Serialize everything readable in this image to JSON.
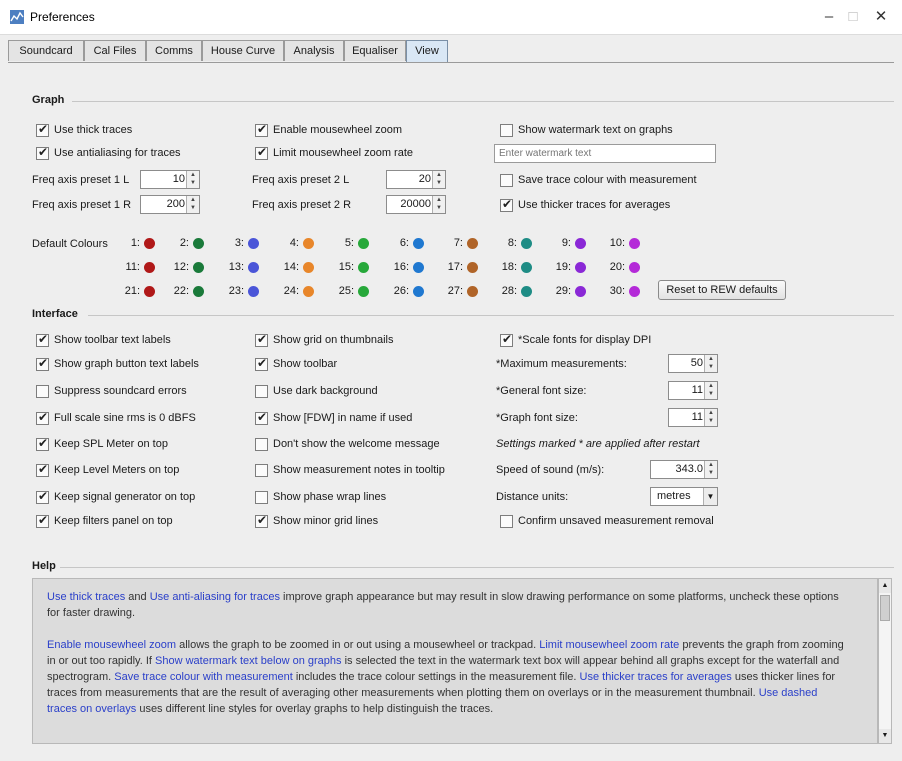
{
  "window": {
    "title": "Preferences",
    "minimize": "–",
    "maximize": "□",
    "close": "✕"
  },
  "tabs": [
    "Soundcard",
    "Cal Files",
    "Comms",
    "House Curve",
    "Analysis",
    "Equaliser",
    "View"
  ],
  "graph": {
    "section_title": "Graph",
    "col1": [
      {
        "label": "Use thick traces",
        "checked": true
      },
      {
        "label": "Use antialiasing for traces",
        "checked": true
      }
    ],
    "col2": [
      {
        "label": "Enable mousewheel zoom",
        "checked": true
      },
      {
        "label": "Limit mousewheel zoom rate",
        "checked": true
      }
    ],
    "col3": [
      {
        "label": "Show watermark text on graphs",
        "checked": false
      }
    ],
    "watermark_placeholder": "Enter watermark text",
    "presets": {
      "p1l_label": "Freq axis preset 1 L",
      "p1l_value": "10",
      "p1r_label": "Freq axis preset 1 R",
      "p1r_value": "200",
      "p2l_label": "Freq axis preset 2 L",
      "p2l_value": "20",
      "p2r_label": "Freq axis preset 2 R",
      "p2r_value": "20000"
    },
    "save_trace_colour": {
      "label": "Save trace colour with measurement",
      "checked": false
    },
    "thicker_averages": {
      "label": "Use thicker traces for averages",
      "checked": true
    },
    "default_colours_label": "Default Colours",
    "colours": [
      {
        "n": "1:",
        "c": "#b01818"
      },
      {
        "n": "2:",
        "c": "#1a7a3a"
      },
      {
        "n": "3:",
        "c": "#4a55d8"
      },
      {
        "n": "4:",
        "c": "#e8862a"
      },
      {
        "n": "5:",
        "c": "#27a83a"
      },
      {
        "n": "6:",
        "c": "#1f78d0"
      },
      {
        "n": "7:",
        "c": "#b06428"
      },
      {
        "n": "8:",
        "c": "#1e8c85"
      },
      {
        "n": "9:",
        "c": "#8a28d6"
      },
      {
        "n": "10:",
        "c": "#b42ad8"
      },
      {
        "n": "11:",
        "c": "#b01818"
      },
      {
        "n": "12:",
        "c": "#1a7a3a"
      },
      {
        "n": "13:",
        "c": "#4a55d8"
      },
      {
        "n": "14:",
        "c": "#e8862a"
      },
      {
        "n": "15:",
        "c": "#27a83a"
      },
      {
        "n": "16:",
        "c": "#1f78d0"
      },
      {
        "n": "17:",
        "c": "#b06428"
      },
      {
        "n": "18:",
        "c": "#1e8c85"
      },
      {
        "n": "19:",
        "c": "#8a28d6"
      },
      {
        "n": "20:",
        "c": "#b42ad8"
      },
      {
        "n": "21:",
        "c": "#b01818"
      },
      {
        "n": "22:",
        "c": "#1a7a3a"
      },
      {
        "n": "23:",
        "c": "#4a55d8"
      },
      {
        "n": "24:",
        "c": "#e8862a"
      },
      {
        "n": "25:",
        "c": "#27a83a"
      },
      {
        "n": "26:",
        "c": "#1f78d0"
      },
      {
        "n": "27:",
        "c": "#b06428"
      },
      {
        "n": "28:",
        "c": "#1e8c85"
      },
      {
        "n": "29:",
        "c": "#8a28d6"
      },
      {
        "n": "30:",
        "c": "#b42ad8"
      }
    ],
    "reset_button": "Reset to REW defaults"
  },
  "interface": {
    "section_title": "Interface",
    "col1": [
      {
        "label": "Show toolbar text labels",
        "checked": true
      },
      {
        "label": "Show graph button text labels",
        "checked": true
      },
      {
        "label": "Suppress soundcard errors",
        "checked": false
      },
      {
        "label": "Full scale sine rms is 0 dBFS",
        "checked": true
      },
      {
        "label": "Keep SPL Meter on top",
        "checked": true
      },
      {
        "label": "Keep Level Meters on top",
        "checked": true
      },
      {
        "label": "Keep signal generator on top",
        "checked": true
      },
      {
        "label": "Keep filters panel on top",
        "checked": true
      }
    ],
    "col2": [
      {
        "label": "Show grid on thumbnails",
        "checked": true
      },
      {
        "label": "Show toolbar",
        "checked": true
      },
      {
        "label": "Use dark background",
        "checked": false
      },
      {
        "label": "Show [FDW] in name if used",
        "checked": true
      },
      {
        "label": "Don't show the welcome message",
        "checked": false
      },
      {
        "label": "Show measurement notes in tooltip",
        "checked": false
      },
      {
        "label": "Show phase wrap lines",
        "checked": false
      },
      {
        "label": "Show minor grid lines",
        "checked": true
      }
    ],
    "scale_fonts": {
      "label": "*Scale fonts for display DPI",
      "checked": true
    },
    "max_meas_label": "*Maximum measurements:",
    "max_meas_value": "50",
    "gen_font_label": "*General font size:",
    "gen_font_value": "11",
    "graph_font_label": "*Graph font size:",
    "graph_font_value": "11",
    "restart_note": "Settings marked * are applied after restart",
    "sos_label": "Speed of sound (m/s):",
    "sos_value": "343.0",
    "dist_label": "Distance units:",
    "dist_value": "metres",
    "confirm_unsaved": {
      "label": "Confirm unsaved measurement removal",
      "checked": false
    }
  },
  "help": {
    "section_title": "Help",
    "p1": [
      {
        "t": "Use thick traces",
        "h": true
      },
      {
        "t": " and ",
        "h": false
      },
      {
        "t": "Use anti-aliasing for traces",
        "h": true
      },
      {
        "t": " improve graph appearance but may result in slow drawing performance on some platforms, uncheck these options for faster drawing.",
        "h": false
      }
    ],
    "p2": [
      {
        "t": "Enable mousewheel zoom",
        "h": true
      },
      {
        "t": " allows the graph to be zoomed in or out using a mousewheel or trackpad. ",
        "h": false
      },
      {
        "t": "Limit mousewheel zoom rate",
        "h": true
      },
      {
        "t": " prevents the graph from zooming in or out too rapidly. If ",
        "h": false
      },
      {
        "t": "Show watermark text below on graphs",
        "h": true
      },
      {
        "t": " is selected the text in the watermark text box will appear behind all graphs except for the waterfall and spectrogram. ",
        "h": false
      },
      {
        "t": "Save trace colour with measurement",
        "h": true
      },
      {
        "t": " includes the trace colour settings in the measurement file. ",
        "h": false
      },
      {
        "t": "Use thicker traces for averages",
        "h": true
      },
      {
        "t": " uses thicker lines for traces from measurements that are the result of averaging other measurements when plotting them on overlays or in the measurement thumbnail. ",
        "h": false
      },
      {
        "t": "Use dashed traces on overlays",
        "h": true
      },
      {
        "t": " uses different line styles for overlay graphs to help distinguish the traces.",
        "h": false
      }
    ]
  }
}
